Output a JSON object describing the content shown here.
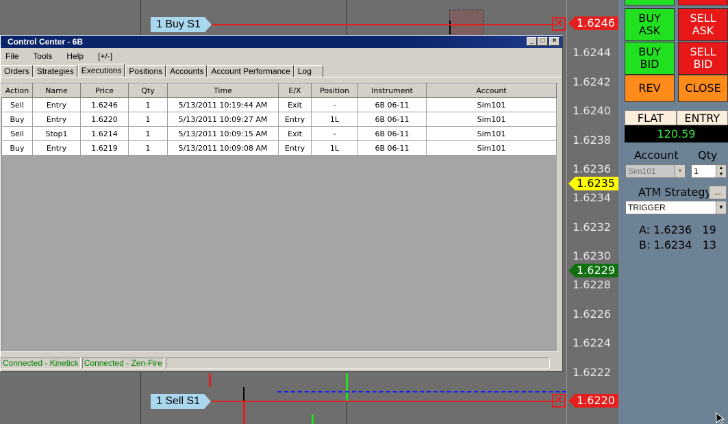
{
  "chart": {
    "ticks": [
      "1.6244",
      "1.6242",
      "1.6240",
      "1.6238",
      "1.6236",
      "1.6234",
      "1.6232",
      "1.6230",
      "1.6228",
      "1.6226",
      "1.6224",
      "1.6222"
    ],
    "tag_top": "1.6246",
    "tag_bid": "1.6235",
    "tag_last": "1.6229",
    "tag_bottom": "1.6220",
    "buy_order_label": "1  Buy S1",
    "sell_order_label": "1  Sell S1",
    "colors": {
      "red": "#e61e1e",
      "yellow": "#ffff00",
      "green": "#107010"
    }
  },
  "window": {
    "title": "Control Center - 6B",
    "menu": [
      "File",
      "Tools",
      "Help",
      "[+/-]"
    ],
    "tabs": [
      "Orders",
      "Strategies",
      "Executions",
      "Positions",
      "Accounts",
      "Account Performance",
      "Log"
    ],
    "active_tab": "Executions",
    "columns": [
      "Action",
      "Name",
      "Price",
      "Qty",
      "Time",
      "E/X",
      "Position",
      "Instrument",
      "Account"
    ],
    "rows": [
      [
        "Sell",
        "Entry",
        "1.6246",
        "1",
        "5/13/2011 10:19:44 AM",
        "Exit",
        "-",
        "6B 06-11",
        "Sim101"
      ],
      [
        "Buy",
        "Entry",
        "1.6220",
        "1",
        "5/13/2011 10:09:27 AM",
        "Entry",
        "1L",
        "6B 06-11",
        "Sim101"
      ],
      [
        "Sell",
        "Stop1",
        "1.6214",
        "1",
        "5/13/2011 10:09:15 AM",
        "Exit",
        "-",
        "6B 06-11",
        "Sim101"
      ],
      [
        "Buy",
        "Entry",
        "1.6219",
        "1",
        "5/13/2011 10:09:08 AM",
        "Entry",
        "1L",
        "6B 06-11",
        "Sim101"
      ]
    ],
    "status": [
      "Connected - Kinetick",
      "Connected - Zen-Fire"
    ]
  },
  "panel": {
    "buy_ask": "BUY\nASK",
    "sell_ask": "SELL\nASK",
    "buy_bid": "BUY\nBID",
    "sell_bid": "SELL\nBID",
    "rev": "REV",
    "close": "CLOSE",
    "position": "FLAT",
    "entry": "ENTRY",
    "pnl": "120.59",
    "account_label": "Account",
    "qty_label": "Qty",
    "account_value": "Sim101",
    "qty_value": "1",
    "atm_label": "ATM Strategy",
    "atm_more": "...",
    "atm_value": "TRIGGER",
    "ask_line": "A: 1.6236   19",
    "bid_line": "B: 1.6234   13"
  }
}
